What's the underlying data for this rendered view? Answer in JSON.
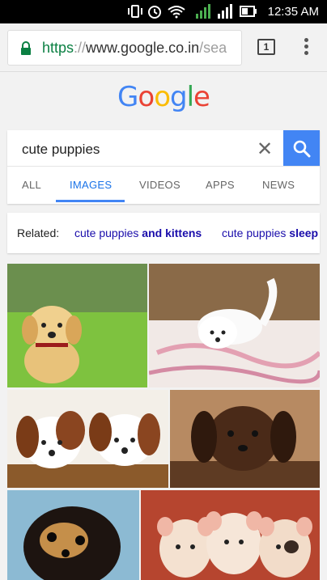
{
  "status_bar": {
    "time": "12:35 AM",
    "icons": [
      "vibrate-icon",
      "alarm-icon",
      "wifi-icon",
      "signal-1-icon",
      "signal-2-icon",
      "battery-icon"
    ]
  },
  "browser": {
    "url_scheme": "https",
    "url_sep": "://",
    "url_host": "www.google.co.in",
    "url_path": "/sea",
    "tab_count": "1"
  },
  "logo": {
    "letters": [
      "G",
      "o",
      "o",
      "g",
      "l",
      "e"
    ]
  },
  "search": {
    "query": "cute puppies"
  },
  "tabs": [
    {
      "label": "ALL",
      "active": false
    },
    {
      "label": "IMAGES",
      "active": true
    },
    {
      "label": "VIDEOS",
      "active": false
    },
    {
      "label": "APPS",
      "active": false
    },
    {
      "label": "NEWS",
      "active": false
    }
  ],
  "related": {
    "label": "Related:",
    "chips": [
      {
        "normal": "cute puppies ",
        "bold": "and kittens"
      },
      {
        "normal": "cute puppies ",
        "bold": "sleep"
      }
    ]
  },
  "colors": {
    "google_blue": "#4285f4",
    "google_red": "#ea4335",
    "google_yellow": "#fbbc05",
    "google_green": "#34a853",
    "active_tab": "#1a73e8",
    "secure_green": "#0b8043"
  }
}
